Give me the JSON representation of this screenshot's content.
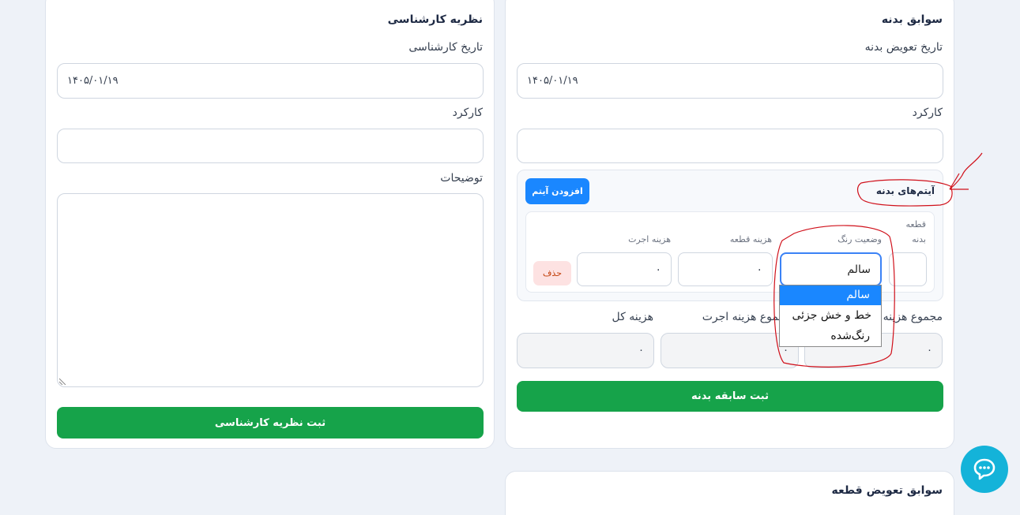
{
  "expert": {
    "title": "نظریه کارشناسی",
    "date_label": "تاریخ کارشناسی",
    "date_value": "۱۴۰۵/۰۱/۱۹",
    "mileage_label": "کارکرد",
    "mileage_value": "",
    "notes_label": "توضیحات",
    "notes_value": "",
    "submit_label": "ثبت نظریه کارشناسی"
  },
  "body_history": {
    "title": "سوابق بدنه",
    "date_label": "تاریخ تعویض بدنه",
    "date_value": "۱۴۰۵/۰۱/۱۹",
    "mileage_label": "کارکرد",
    "mileage_value": "",
    "items": {
      "title": "آیتم‌های بدنه",
      "add_label": "افزودن آیتم",
      "row": {
        "part_label_1": "قطعه",
        "part_label_2": "بدنه",
        "paint_label": "وضعیت رنگ",
        "paint_value": "سالم",
        "part_cost_label": "هزینه قطعه",
        "part_cost_value": "۰",
        "labor_cost_label": "هزینه اجرت",
        "labor_cost_value": "۰",
        "delete_label": "حذف"
      },
      "paint_options": [
        "سالم",
        "خط و خش جزئی",
        "رنگ‌شده"
      ]
    },
    "totals": {
      "parts_label": "مجموع هزینه",
      "parts_value": "۰",
      "labor_label": "مجموع هزینه اجرت",
      "labor_value": "۰",
      "total_label": "هزینه کل",
      "total_value": "۰"
    },
    "submit_label": "ثبت سابقه بدنه"
  },
  "part_history": {
    "title": "سوابق تعویض قطعه"
  },
  "colors": {
    "primary": "#1a87ff",
    "success": "#16a34a",
    "annotation": "#d0101a",
    "chat": "#14b3d9"
  },
  "chat_icon": "chat-bubble-icon"
}
